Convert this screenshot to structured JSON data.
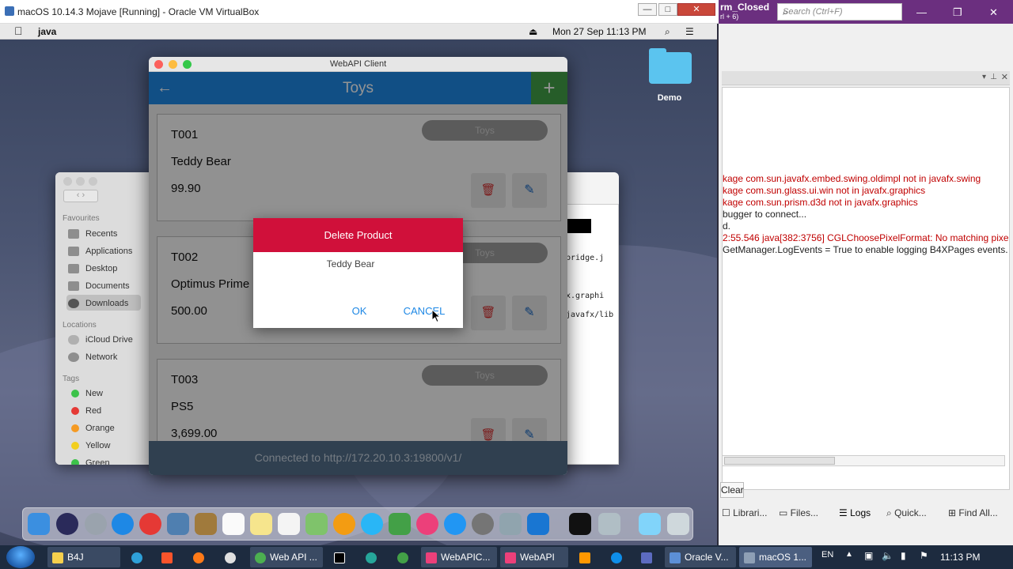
{
  "vbox": {
    "title": "macOS 10.14.3 Mojave [Running] - Oracle VM VirtualBox",
    "minimize": "—",
    "restore": "□",
    "close": "✕"
  },
  "mac_menubar": {
    "app_name": "java",
    "datetime": "Mon 27 Sep  11:13 PM"
  },
  "finder": {
    "favourites_label": "Favourites",
    "favourites": [
      "Recents",
      "Applications",
      "Desktop",
      "Documents",
      "Downloads"
    ],
    "locations_label": "Locations",
    "locations": [
      "iCloud Drive",
      "Network"
    ],
    "tags_label": "Tags",
    "tags": [
      {
        "label": "New",
        "color": "#3cc24a"
      },
      {
        "label": "Red",
        "color": "#e53935"
      },
      {
        "label": "Orange",
        "color": "#f59a23"
      },
      {
        "label": "Yellow",
        "color": "#f2cf1f"
      },
      {
        "label": "Green",
        "color": "#3cc24a"
      }
    ]
  },
  "term": {
    "lines": [
      "bridge.j",
      "x.graphi",
      "javafx/lib"
    ]
  },
  "desktop": {
    "folder_label": "Demo"
  },
  "app": {
    "window_title": "WebAPI Client",
    "header_title": "Toys",
    "add_icon": "+",
    "back_icon": "←",
    "cards": [
      {
        "id": "T001",
        "name": "Teddy Bear",
        "price": "99.90",
        "category": "Toys"
      },
      {
        "id": "T002",
        "name": "Optimus Prime",
        "price": "500.00",
        "category": "Toys"
      },
      {
        "id": "T003",
        "name": "PS5",
        "price": "3,699.00",
        "category": "Toys"
      }
    ],
    "footer": "Connected to http://172.20.10.3:19800/v1/"
  },
  "dialog": {
    "title": "Delete Product",
    "message": "Teddy Bear",
    "ok_label": "OK",
    "cancel_label": "CANCEL"
  },
  "ide": {
    "tab_name": "rm_Closed",
    "tab_shortcut": "rl + 6)",
    "search_placeholder": "Search (Ctrl+F)",
    "log_lines": [
      {
        "text": "kage com.sun.javafx.embed.swing.oldimpl not in javafx.swing",
        "color": "#c00000"
      },
      {
        "text": "kage com.sun.glass.ui.win not in javafx.graphics",
        "color": "#c00000"
      },
      {
        "text": "kage com.sun.prism.d3d not in javafx.graphics",
        "color": "#c00000"
      },
      {
        "text": "bugger to connect...",
        "color": "#222222"
      },
      {
        "text": "d.",
        "color": "#222222"
      },
      {
        "text": "2:55.546 java[382:3756] CGLChoosePixelFormat: No matching pixel",
        "color": "#c00000"
      },
      {
        "text": "GetManager.LogEvents = True to enable logging B4XPages events.",
        "color": "#222222"
      }
    ],
    "clear_label": "Clear",
    "bottom_tabs": [
      "Librari...",
      "Files...",
      "Logs",
      "Quick...",
      "Find All..."
    ]
  },
  "taskbar": {
    "buttons": [
      "B4J",
      "Web API ...",
      "WebAPIC...",
      "WebAPI -...",
      "Oracle V...",
      "macOS 1..."
    ],
    "language": "EN",
    "clock": "11:13 PM"
  }
}
